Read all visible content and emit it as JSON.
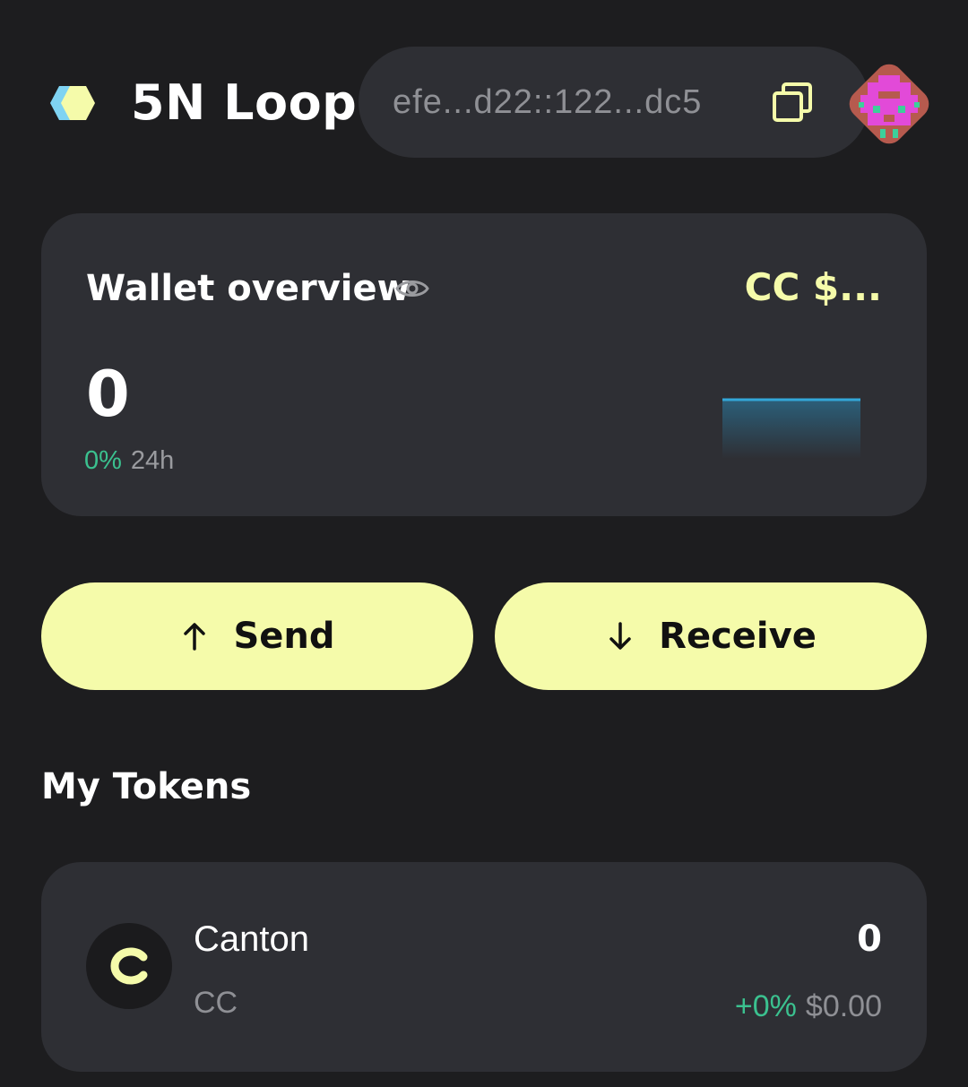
{
  "header": {
    "app_title": "5N Loop",
    "logo_icon": "diamond-logo-icon",
    "address": "efe...d22::122...dc5",
    "copy_icon": "copy-icon",
    "avatar_icon": "pixel-avatar-icon"
  },
  "wallet": {
    "title": "Wallet overview",
    "visibility_icon": "eye-icon",
    "price_label": "CC $...",
    "balance": "0",
    "change_percent": "0%",
    "change_period": "24h"
  },
  "actions": {
    "send_label": "Send",
    "send_icon": "arrow-up-icon",
    "receive_label": "Receive",
    "receive_icon": "arrow-down-icon"
  },
  "tokens": {
    "section_title": "My Tokens",
    "items": [
      {
        "name": "Canton",
        "symbol": "CC",
        "icon": "canton-c-icon",
        "amount": "0",
        "change": "+0%",
        "value": "$0.00"
      }
    ]
  },
  "colors": {
    "background": "#1d1d1f",
    "card": "#2e2f34",
    "accent": "#f5fbaa",
    "positive": "#3bc18f",
    "muted": "#8f9095"
  }
}
